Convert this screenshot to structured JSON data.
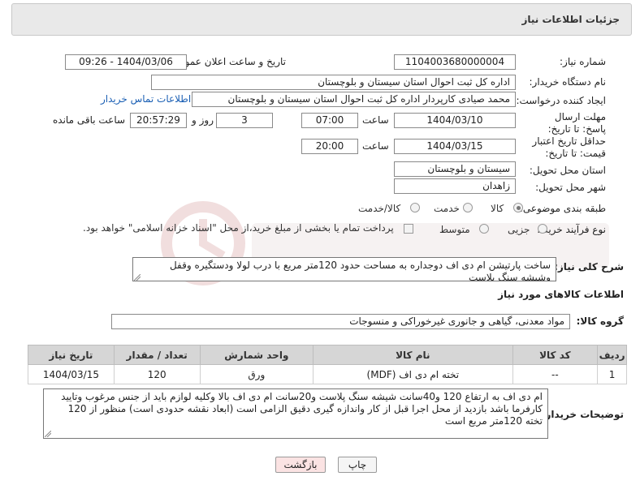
{
  "panel": {
    "title": "جزئیات اطلاعات نیاز"
  },
  "fields": {
    "need_number_label": "شماره نیاز:",
    "need_number": "1104003680000004",
    "announce_label": "تاریخ و ساعت اعلان عمومی:",
    "announce_value": "1404/03/06 - 09:26",
    "buyer_org_label": "نام دستگاه خریدار:",
    "buyer_org": "اداره کل ثبت احوال استان سیستان و بلوچستان",
    "creator_label": "ایجاد کننده درخواست:",
    "creator": "محمد صیادی کارپردار اداره کل ثبت احوال استان سیستان و بلوچستان",
    "contact_link": "اطلاعات تماس خریدار",
    "deadline_label": "مهلت ارسال پاسخ: تا تاریخ:",
    "deadline_date": "1404/03/10",
    "time_label": "ساعت",
    "deadline_time": "07:00",
    "days_value": "3",
    "days_label": "روز و",
    "remaining_value": "20:57:29",
    "remaining_label": "ساعت باقی مانده",
    "validity_label": "حداقل تاریخ اعتبار قیمت: تا تاریخ:",
    "validity_date": "1404/03/15",
    "validity_time": "20:00",
    "province_label": "استان محل تحویل:",
    "province": "سیستان و بلوچستان",
    "city_label": "شهر محل تحویل:",
    "city": "زاهدان",
    "category_label": "طبقه بندی موضوعی:",
    "category_options": [
      "کالا",
      "خدمت",
      "کالا/خدمت"
    ],
    "category_selected": "کالا",
    "process_label": "نوع فرآیند خرید :",
    "process_options": [
      "جزیی",
      "متوسط"
    ],
    "payment_note": "پرداخت تمام یا بخشی از مبلغ خرید،از محل \"اسناد خزانه اسلامی\" خواهد بود."
  },
  "description": {
    "label": "شرح کلی نیاز:",
    "text": "ساخت پارتیشن ام دی اف دوجداره به مساحت حدود 120متر مربع با درب لولا ودستگیره وقفل وشیشه سنگ پلاست"
  },
  "goods": {
    "section_title": "اطلاعات کالاهای مورد نیاز",
    "group_label": "گروه کالا:",
    "group_value": "مواد معدنی، گیاهی و جانوری غیرخوراکی و منسوجات",
    "columns": [
      "ردیف",
      "کد کالا",
      "نام کالا",
      "واحد شمارش",
      "تعداد / مقدار",
      "تاریخ نیاز"
    ],
    "rows": [
      [
        "1",
        "--",
        "تخته ام دی اف (MDF)",
        "ورق",
        "120",
        "1404/03/15"
      ]
    ]
  },
  "buyer_notes": {
    "label": "توضیحات خریدار:",
    "text": "ام دی اف به ارتفاع 120 و40سانت شیشه سنگ پلاست و20سانت ام دی اف بالا وکلیه لوازم  باید از جنس مرغوب وتایید کارفرما باشد بازدید از محل اجرا  قبل از کار واندازه گیری دقیق الزامی است (ابعاد نقشه حدودی است) منظور از 120 تخته 120متر مربع است"
  },
  "buttons": {
    "print": "چاپ",
    "back": "بازگشت"
  },
  "colors": {
    "link": "#1a5fb4",
    "back_button_bg": "#fbe3e3",
    "table_header": "#d6d6d6"
  }
}
